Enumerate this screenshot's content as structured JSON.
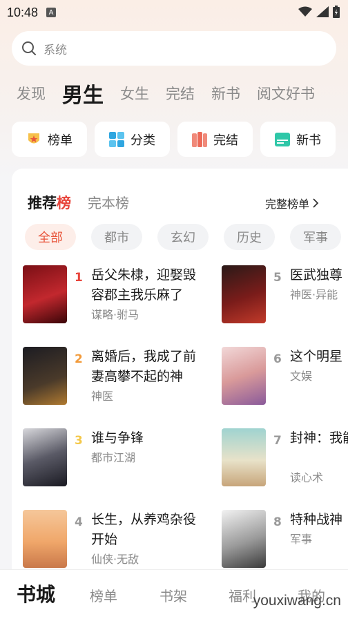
{
  "status": {
    "time": "10:48"
  },
  "search": {
    "placeholder": "系统"
  },
  "channels": [
    "发现",
    "男生",
    "女生",
    "完结",
    "新书",
    "阅文好书"
  ],
  "quick": [
    {
      "label": "榜单",
      "icon": "trophy-icon"
    },
    {
      "label": "分类",
      "icon": "grid-icon"
    },
    {
      "label": "完结",
      "icon": "books-icon"
    },
    {
      "label": "新书",
      "icon": "new-badge-icon"
    }
  ],
  "ranking": {
    "tab_active_prefix": "推荐",
    "tab_active_suffix": "榜",
    "tab_other": "完本榜",
    "full_label": "完整榜单",
    "genres": [
      "全部",
      "都市",
      "玄幻",
      "历史",
      "军事"
    ]
  },
  "books": [
    {
      "rank": "1",
      "title": "岳父朱棣，迎娶毁容郡主我乐麻了",
      "tag": "谋略·驸马",
      "rank_color": "#e8453c"
    },
    {
      "rank": "2",
      "title": "离婚后，我成了前妻高攀不起的神",
      "tag": "神医",
      "rank_color": "#f29a3a"
    },
    {
      "rank": "3",
      "title": "谁与争锋",
      "tag": "都市江湖",
      "rank_color": "#f4c84a"
    },
    {
      "rank": "4",
      "title": "长生，从养鸡杂役开始",
      "tag": "仙侠·无敌",
      "rank_color": "#9a9a9a"
    },
    {
      "rank": "5",
      "title": "医武独尊",
      "tag": "神医·异能",
      "rank_color": "#9a9a9a"
    },
    {
      "rank": "6",
      "title": "这个明星",
      "tag": "文娱",
      "rank_color": "#9a9a9a"
    },
    {
      "rank": "7",
      "title": "封神：我能听心声",
      "tag": "读心术",
      "rank_color": "#9a9a9a"
    },
    {
      "rank": "8",
      "title": "特种战神",
      "tag": "军事",
      "rank_color": "#9a9a9a"
    }
  ],
  "nav": [
    "书城",
    "榜单",
    "书架",
    "福利",
    "我的"
  ],
  "watermark": "youxiwang.cn"
}
